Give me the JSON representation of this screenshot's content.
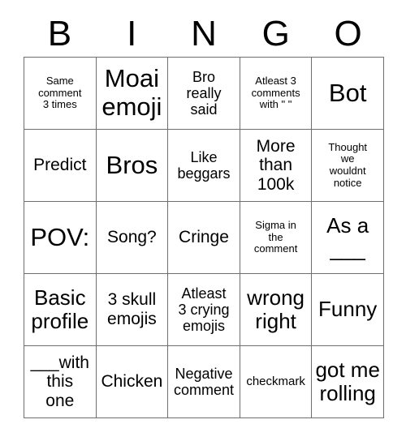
{
  "card": {
    "header_letters": [
      "B",
      "I",
      "N",
      "G",
      "O"
    ],
    "rows": [
      [
        {
          "text": "Same\ncomment\n3 times",
          "size": "xs"
        },
        {
          "text": "Moai\nemoji",
          "size": "xxl"
        },
        {
          "text": "Bro\nreally\nsaid",
          "size": "m"
        },
        {
          "text": "Atleast 3\ncomments\nwith \" \"",
          "size": "xs"
        },
        {
          "text": "Bot",
          "size": "xxl"
        }
      ],
      [
        {
          "text": "Predict",
          "size": "l"
        },
        {
          "text": "Bros",
          "size": "xxl"
        },
        {
          "text": "Like\nbeggars",
          "size": "m"
        },
        {
          "text": "More\nthan\n100k",
          "size": "l"
        },
        {
          "text": "Thought\nwe\nwouldnt\nnotice",
          "size": "xs"
        }
      ],
      [
        {
          "text": "POV:",
          "size": "xxl"
        },
        {
          "text": "Song?",
          "size": "l"
        },
        {
          "text": "Cringe",
          "size": "l"
        },
        {
          "text": "Sigma in\nthe\ncomment",
          "size": "xs"
        },
        {
          "text": "As a\n___",
          "size": "xl"
        }
      ],
      [
        {
          "text": "Basic\nprofile",
          "size": "xl"
        },
        {
          "text": "3 skull\nemojis",
          "size": "l"
        },
        {
          "text": "Atleast\n3 crying\nemojis",
          "size": "m"
        },
        {
          "text": "wrong\nright",
          "size": "xl"
        },
        {
          "text": "Funny",
          "size": "xl"
        }
      ],
      [
        {
          "text": "___with\nthis\none",
          "size": "l"
        },
        {
          "text": "Chicken",
          "size": "l"
        },
        {
          "text": "Negative\ncomment",
          "size": "m"
        },
        {
          "text": "checkmark",
          "size": "s"
        },
        {
          "text": "got me\nrolling",
          "size": "xl"
        }
      ]
    ]
  },
  "colors": {
    "background": "#ffffff",
    "text": "#000000",
    "grid_line": "#6f6f6f"
  }
}
